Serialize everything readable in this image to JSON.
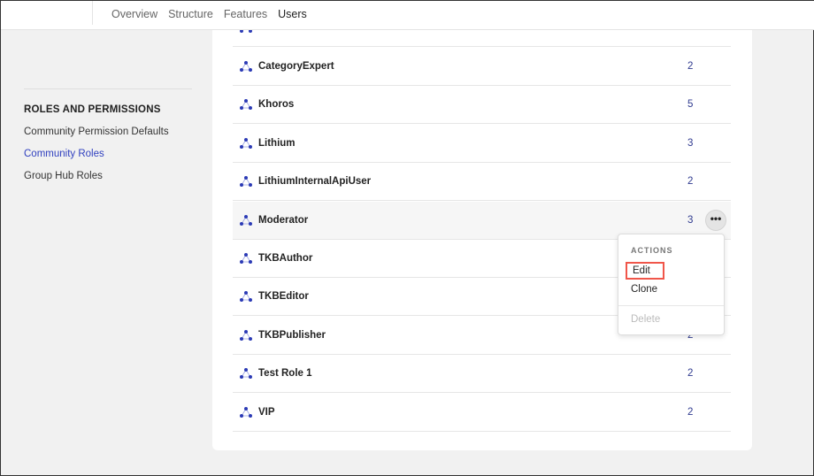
{
  "nav": {
    "items": [
      "Overview",
      "Structure",
      "Features",
      "Users"
    ],
    "active": "Users"
  },
  "sidebar": {
    "heading": "ROLES AND PERMISSIONS",
    "items": [
      "Community Permission Defaults",
      "Community Roles",
      "Group Hub Roles"
    ],
    "selected": "Community Roles"
  },
  "roles": [
    {
      "name": "CategoryExpert",
      "count": "2"
    },
    {
      "name": "Khoros",
      "count": "5"
    },
    {
      "name": "Lithium",
      "count": "3"
    },
    {
      "name": "LithiumInternalApiUser",
      "count": "2"
    },
    {
      "name": "Moderator",
      "count": "3"
    },
    {
      "name": "TKBAuthor",
      "count": ""
    },
    {
      "name": "TKBEditor",
      "count": ""
    },
    {
      "name": "TKBPublisher",
      "count": "2"
    },
    {
      "name": "Test Role 1",
      "count": "2"
    },
    {
      "name": "VIP",
      "count": "2"
    }
  ],
  "menu": {
    "heading": "ACTIONS",
    "edit": "Edit",
    "clone": "Clone",
    "delete": "Delete"
  },
  "colors": {
    "accent": "#2f3fbf",
    "highlight": "#f0564a"
  },
  "icons": {
    "role": "role-network-icon",
    "more": "more-horizontal-icon"
  }
}
